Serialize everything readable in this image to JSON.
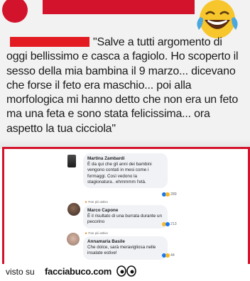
{
  "post": {
    "first_line": "\"Salve a tutti argomento di",
    "body": "oggi bellissimo e casca a fagiolo. Ho scoperto il sesso della mia bambina il 9 marzo... dicevano che forse il feto era maschio... poi alla morfologica mi hanno detto che non era un feto ma una feta e sono stata felicissima... ora aspetto la tua cicciola\""
  },
  "comments": [
    {
      "badge": "",
      "name": "Martina Zambardi",
      "text": "È da qui che gli anni dei bambini vengono contati in mesi come i formaggi. Così vedono la stagionatura.. ehmmmm l'età.",
      "reactions": "289"
    },
    {
      "badge": "Fan più attivo",
      "name": "Marco Capone",
      "text": "È il risultato di una burrata durante un pecorino",
      "reactions": "213"
    },
    {
      "badge": "Fan più attivo",
      "name": "Annamaria Basile",
      "text": "Che dolce, sarà meravigliosa nelle insalate estive!",
      "reactions": "44"
    }
  ],
  "footer": {
    "prefix": "visto su",
    "brand": "facciabuco.com"
  },
  "colors": {
    "accent_red": "#d3122b",
    "like_blue": "#1877f2",
    "haha_yellow": "#f7b928"
  },
  "icons": [
    "laughing-emoji-icon",
    "like-icon",
    "haha-icon",
    "star-icon",
    "eyes-icon"
  ]
}
